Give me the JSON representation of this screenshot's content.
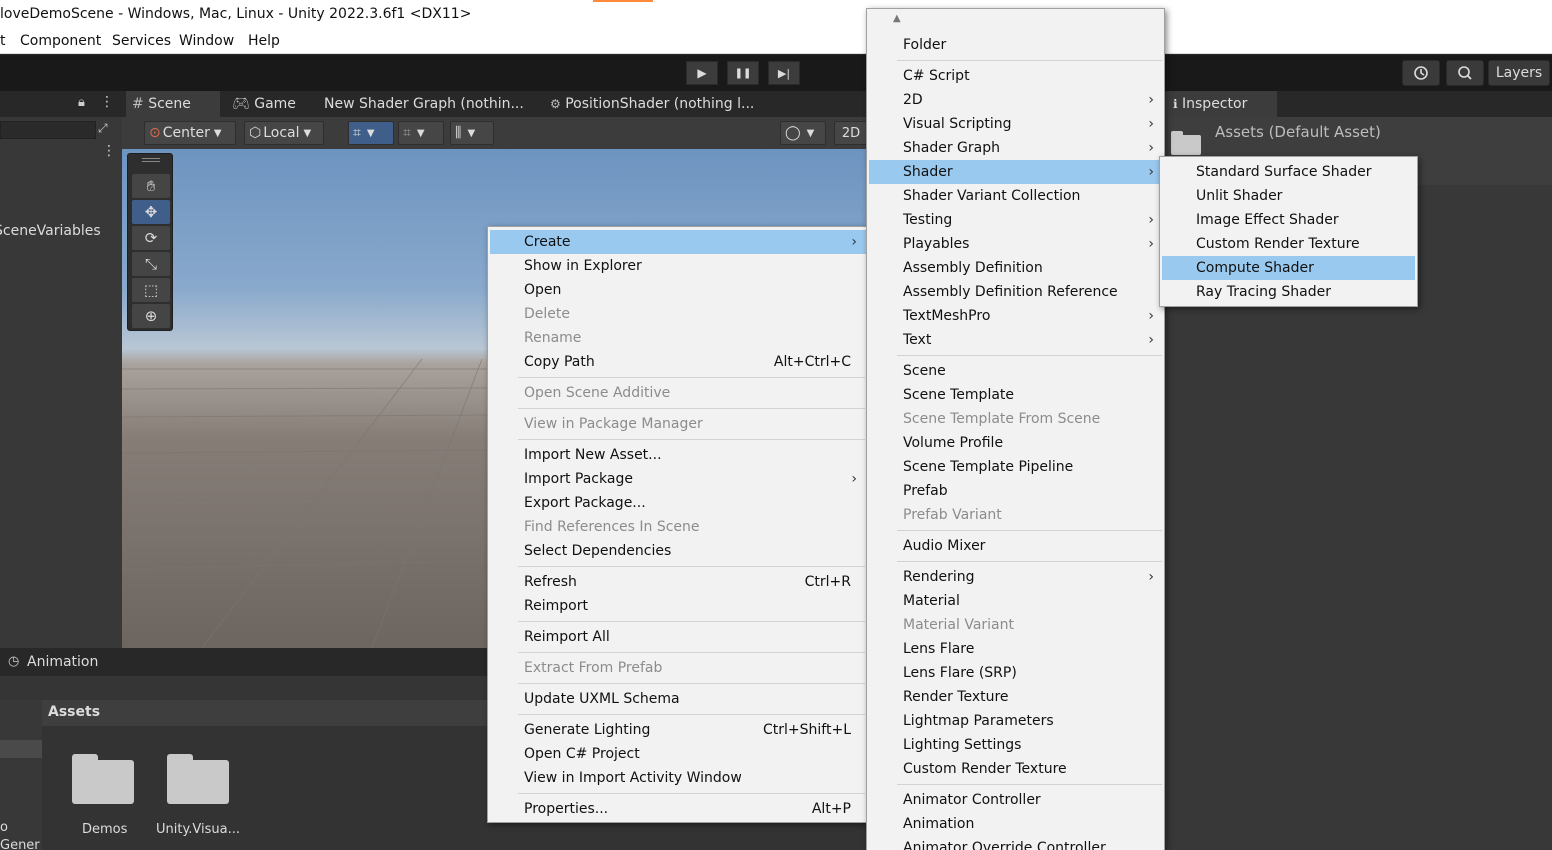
{
  "window": {
    "title": "loveDemoScene - Windows, Mac, Linux - Unity 2022.3.6f1 <DX11>"
  },
  "menubar": {
    "items": [
      "t",
      "Component",
      "Services",
      "Window",
      "Help"
    ]
  },
  "toolbar": {
    "play_icon": "▶",
    "pause_icon": "❚❚",
    "step_icon": "▶|",
    "history_icon": "history-icon",
    "search_icon": "search-icon",
    "layers_label": "Layers"
  },
  "scene_tabs": {
    "scene": "Scene",
    "game": "Game",
    "shader_graph": "New Shader Graph (nothin...",
    "position_shader": "PositionShader (nothing l..."
  },
  "scene_toolbar": {
    "pivot": "Center",
    "space": "Local",
    "mode_2d": "2D"
  },
  "hierarchy": {
    "item": "SceneVariables"
  },
  "animation_tab": "Animation",
  "project": {
    "header": "Assets",
    "left_labels": [
      "o",
      "Gener"
    ],
    "folders": [
      "Demos",
      "Unity.Visua..."
    ]
  },
  "inspector": {
    "tab": "Inspector",
    "title": "Assets (Default Asset)"
  },
  "context_menu": {
    "items": [
      {
        "label": "Create",
        "submenu": true,
        "highlighted": true
      },
      {
        "label": "Show in Explorer"
      },
      {
        "label": "Open"
      },
      {
        "label": "Delete",
        "disabled": true
      },
      {
        "label": "Rename",
        "disabled": true
      },
      {
        "label": "Copy Path",
        "shortcut": "Alt+Ctrl+C"
      },
      {
        "label": "Open Scene Additive",
        "disabled": true
      },
      {
        "label": "View in Package Manager",
        "disabled": true
      },
      {
        "label": "Import New Asset..."
      },
      {
        "label": "Import Package",
        "submenu": true
      },
      {
        "label": "Export Package..."
      },
      {
        "label": "Find References In Scene",
        "disabled": true
      },
      {
        "label": "Select Dependencies"
      },
      {
        "label": "Refresh",
        "shortcut": "Ctrl+R"
      },
      {
        "label": "Reimport"
      },
      {
        "label": "Reimport All"
      },
      {
        "label": "Extract From Prefab",
        "disabled": true
      },
      {
        "label": "Update UXML Schema"
      },
      {
        "label": "Generate Lighting",
        "shortcut": "Ctrl+Shift+L"
      },
      {
        "label": "Open C# Project"
      },
      {
        "label": "View in Import Activity Window"
      },
      {
        "label": "Properties...",
        "shortcut": "Alt+P"
      }
    ]
  },
  "create_menu": {
    "items": [
      {
        "label": "Folder"
      },
      {
        "label": "C# Script"
      },
      {
        "label": "2D",
        "submenu": true
      },
      {
        "label": "Visual Scripting",
        "submenu": true
      },
      {
        "label": "Shader Graph",
        "submenu": true
      },
      {
        "label": "Shader",
        "submenu": true,
        "highlighted": true
      },
      {
        "label": "Shader Variant Collection"
      },
      {
        "label": "Testing",
        "submenu": true
      },
      {
        "label": "Playables",
        "submenu": true
      },
      {
        "label": "Assembly Definition"
      },
      {
        "label": "Assembly Definition Reference"
      },
      {
        "label": "TextMeshPro",
        "submenu": true
      },
      {
        "label": "Text",
        "submenu": true
      },
      {
        "label": "Scene"
      },
      {
        "label": "Scene Template"
      },
      {
        "label": "Scene Template From Scene",
        "disabled": true
      },
      {
        "label": "Volume Profile"
      },
      {
        "label": "Scene Template Pipeline"
      },
      {
        "label": "Prefab"
      },
      {
        "label": "Prefab Variant",
        "disabled": true
      },
      {
        "label": "Audio Mixer"
      },
      {
        "label": "Rendering",
        "submenu": true
      },
      {
        "label": "Material"
      },
      {
        "label": "Material Variant",
        "disabled": true
      },
      {
        "label": "Lens Flare"
      },
      {
        "label": "Lens Flare (SRP)"
      },
      {
        "label": "Render Texture"
      },
      {
        "label": "Lightmap Parameters"
      },
      {
        "label": "Lighting Settings"
      },
      {
        "label": "Custom Render Texture"
      },
      {
        "label": "Animator Controller"
      },
      {
        "label": "Animation"
      },
      {
        "label": "Animator Override Controller"
      }
    ]
  },
  "shader_menu": {
    "items": [
      {
        "label": "Standard Surface Shader"
      },
      {
        "label": "Unlit Shader"
      },
      {
        "label": "Image Effect Shader"
      },
      {
        "label": "Custom Render Texture"
      },
      {
        "label": "Compute Shader",
        "highlighted": true
      },
      {
        "label": "Ray Tracing Shader"
      }
    ]
  }
}
